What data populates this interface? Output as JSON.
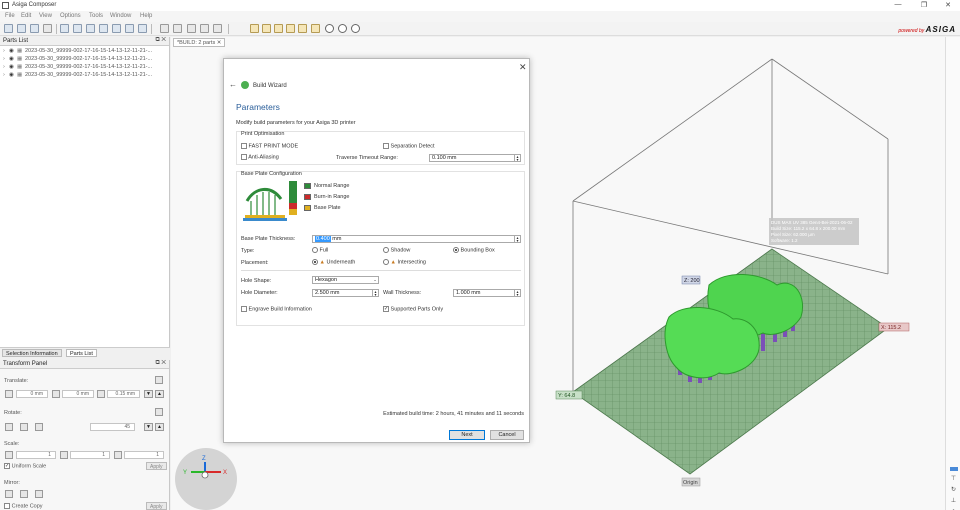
{
  "window": {
    "title": "Asiga Composer",
    "minimize": "—",
    "restore": "❐",
    "close": "✕"
  },
  "menu": [
    "File",
    "Edit",
    "View",
    "Options",
    "Tools",
    "Window",
    "Help"
  ],
  "brand": {
    "prefix": "powered by",
    "name": "ASIGA"
  },
  "parts_list": {
    "title": "Parts List",
    "items": [
      "2023-05-30_99999-002-17-16-15-14-13-12-11-21-...",
      "2023-05-30_99999-002-17-16-15-14-13-12-11-21-...",
      "2023-05-30_99999-002-17-16-15-14-13-12-11-21-...",
      "2023-05-30_99999-002-17-16-15-14-13-12-11-21-..."
    ]
  },
  "bottom_tabs": [
    "Selection Information",
    "Parts List"
  ],
  "transform": {
    "title": "Transform Panel",
    "translate_label": "Translate:",
    "translate_values": [
      "0 mm",
      "0 mm",
      "0.15 mm"
    ],
    "rotate_label": "Rotate:",
    "rotate_value": "45",
    "scale_label": "Scale:",
    "scale_values": [
      "1",
      "1",
      "1"
    ],
    "uniform_scale": "Uniform Scale",
    "apply": "Apply",
    "mirror_label": "Mirror:",
    "create_copy": "Create Copy"
  },
  "viewport": {
    "tab_label": "*BUILD: 2 parts",
    "info_lines": [
      "DUS MAX UV 385 Gen4-Bei-2021-06-02",
      "Build Size: 115.2 x 64.8 x 200.00 mm",
      "Pixel Size: 62.000 µm",
      "Software: 1.2"
    ],
    "z_label": "Z: 200",
    "x_label": "X: 115.2",
    "y_label": "Y: 64.8",
    "origin_label": "Origin"
  },
  "dialog": {
    "wizard_title": "Build Wizard",
    "page_title": "Parameters",
    "subtitle": "Modify build parameters for your Asiga 3D printer",
    "print_opt": {
      "title": "Print Optimisation",
      "fast_print": "FAST PRINT MODE",
      "separation_detect": "Separation Detect",
      "anti_aliasing": "Anti-Aliasing",
      "traverse_label": "Traverse Timeout Range:",
      "traverse_value": "0.100 mm"
    },
    "base_plate": {
      "title": "Base Plate Configuration",
      "legend": [
        {
          "label": "Normal Range",
          "color": "#2e8b3a"
        },
        {
          "label": "Burn-in Range",
          "color": "#cc2a2a"
        },
        {
          "label": "Base Plate",
          "color": "#e0b020"
        }
      ],
      "thickness_label": "Base Plate Thickness:",
      "thickness_selected": "0.400",
      "thickness_unit": "mm",
      "type_label": "Type:",
      "type_options": [
        "Full",
        "Shadow",
        "Bounding Box"
      ],
      "type_selected": "Bounding Box",
      "placement_label": "Placement:",
      "placement_options": [
        "Underneath",
        "Intersecting"
      ],
      "placement_selected": "Underneath",
      "hole_shape_label": "Hole Shape:",
      "hole_shape_value": "Hexagon",
      "hole_diameter_label": "Hole Diameter:",
      "hole_diameter_value": "2.500 mm",
      "wall_thickness_label": "Wall Thickness:",
      "wall_thickness_value": "1.000 mm",
      "engrave_label": "Engrave Build Information",
      "supported_only_label": "Supported Parts Only"
    },
    "estimated": "Estimated build time: 2 hours, 41 minutes and 11 seconds",
    "next": "Next",
    "cancel": "Cancel"
  },
  "nav_axes": {
    "x": "X",
    "y": "Y",
    "z": "Z"
  }
}
